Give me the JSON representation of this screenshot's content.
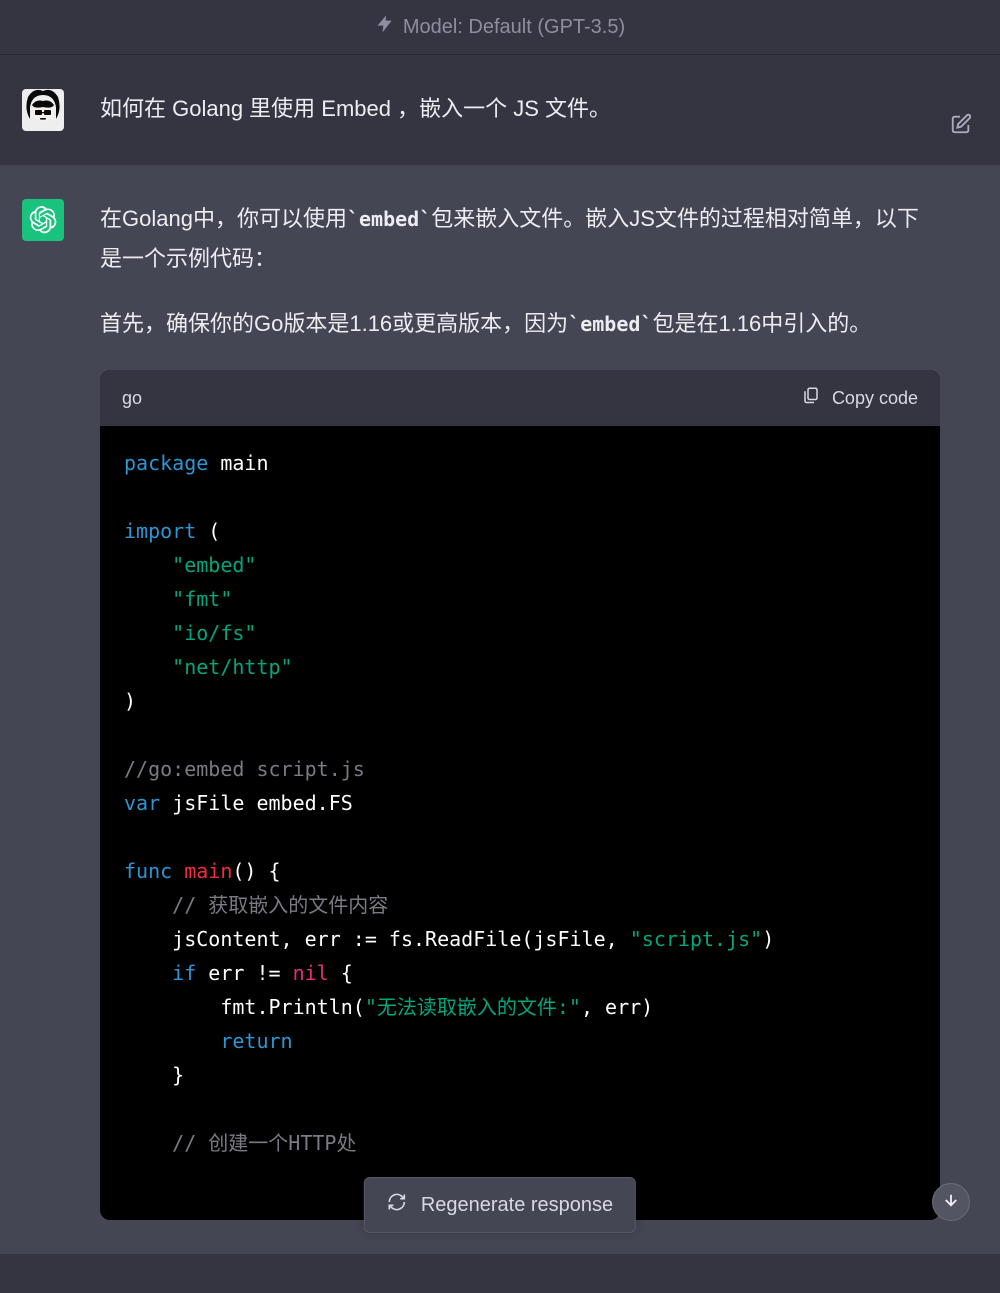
{
  "model_bar": {
    "label": "Model: Default (GPT-3.5)"
  },
  "user_message": {
    "text": "如何在 Golang 里使用 Embed ，嵌入一个 JS 文件。"
  },
  "assistant_message": {
    "p1_a": "在Golang中，你可以使用",
    "p1_code": "`embed`",
    "p1_b": "包来嵌入文件。嵌入JS文件的过程相对简单，以下是一个示例代码：",
    "p2_a": "首先，确保你的Go版本是1.16或更高版本，因为",
    "p2_code": "`embed`",
    "p2_b": "包是在1.16中引入的。"
  },
  "codeblock": {
    "lang": "go",
    "copy_label": "Copy code",
    "tokens": [
      [
        "kw",
        "package"
      ],
      [
        "plain",
        " main\n\n"
      ],
      [
        "kw",
        "import"
      ],
      [
        "plain",
        " (\n    "
      ],
      [
        "str",
        "\"embed\""
      ],
      [
        "plain",
        "\n    "
      ],
      [
        "str",
        "\"fmt\""
      ],
      [
        "plain",
        "\n    "
      ],
      [
        "str",
        "\"io/fs\""
      ],
      [
        "plain",
        "\n    "
      ],
      [
        "str",
        "\"net/http\""
      ],
      [
        "plain",
        "\n)\n\n"
      ],
      [
        "cmt",
        "//go:embed script.js"
      ],
      [
        "plain",
        "\n"
      ],
      [
        "kw",
        "var"
      ],
      [
        "plain",
        " jsFile embed.FS\n\n"
      ],
      [
        "kw",
        "func"
      ],
      [
        "plain",
        " "
      ],
      [
        "main",
        "main"
      ],
      [
        "plain",
        "() {\n    "
      ],
      [
        "cmt",
        "// 获取嵌入的文件内容"
      ],
      [
        "plain",
        "\n    jsContent, err := fs.ReadFile(jsFile, "
      ],
      [
        "str",
        "\"script.js\""
      ],
      [
        "plain",
        ")\n    "
      ],
      [
        "kw",
        "if"
      ],
      [
        "plain",
        " err != "
      ],
      [
        "nil",
        "nil"
      ],
      [
        "plain",
        " {\n        fmt.Println("
      ],
      [
        "str",
        "\"无法读取嵌入的文件:\""
      ],
      [
        "plain",
        ", err)\n        "
      ],
      [
        "kw",
        "return"
      ],
      [
        "plain",
        "\n    }\n\n    "
      ],
      [
        "cmt",
        "// 创建一个HTTP处"
      ],
      [
        "plain",
        "\n"
      ]
    ]
  },
  "buttons": {
    "regenerate": "Regenerate response"
  }
}
